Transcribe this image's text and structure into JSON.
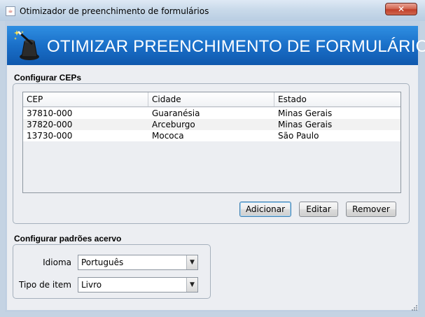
{
  "window": {
    "title": "Otimizador de preenchimento de formulários",
    "close_label": "✕",
    "app_icon": "java-icon"
  },
  "banner": {
    "title": "OTIMIZAR PREENCHIMENTO DE FORMULÁRIOS",
    "icon": "magic-wand-hat-icon"
  },
  "ceps": {
    "section_label": "Configurar CEPs",
    "columns": [
      "CEP",
      "Cidade",
      "Estado"
    ],
    "rows": [
      [
        "37810-000",
        "Guaranésia",
        "Minas Gerais"
      ],
      [
        "37820-000",
        "Arceburgo",
        "Minas Gerais"
      ],
      [
        "13730-000",
        "Mococa",
        "São Paulo"
      ]
    ],
    "buttons": {
      "add": "Adicionar",
      "edit": "Editar",
      "remove": "Remover"
    }
  },
  "acervo": {
    "section_label": "Configurar padrões acervo",
    "idioma_label": "Idioma",
    "idioma_value": "Português",
    "tipo_label": "Tipo de item",
    "tipo_value": "Livro"
  }
}
